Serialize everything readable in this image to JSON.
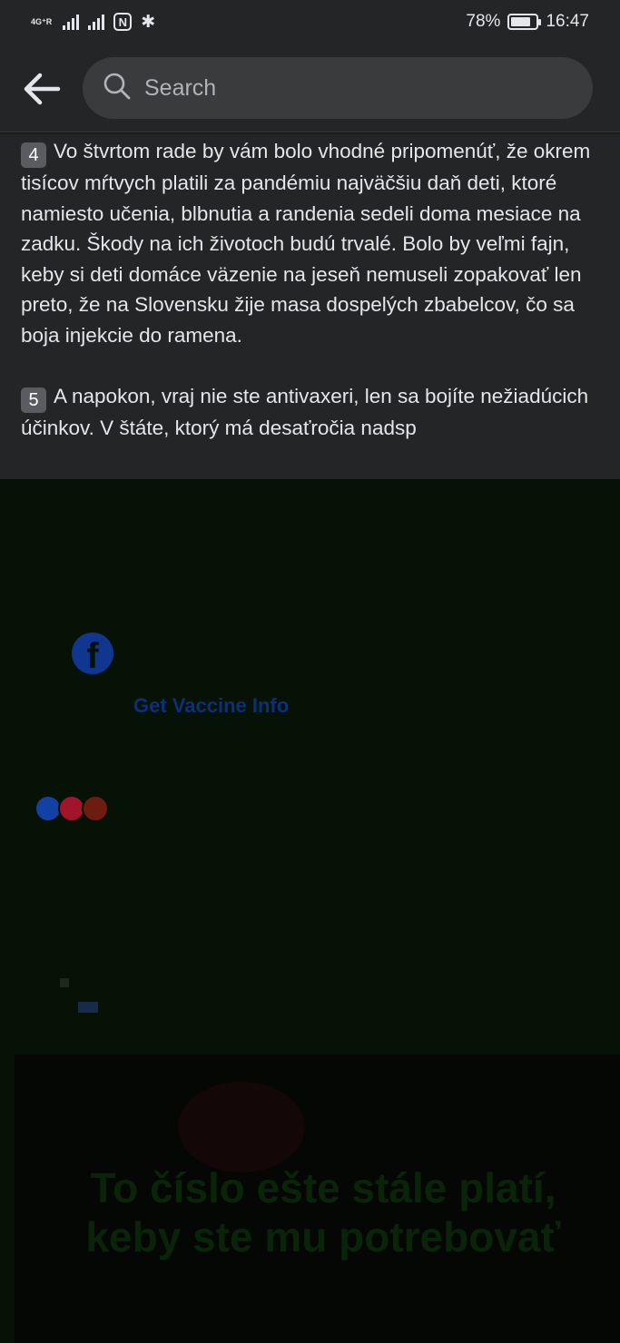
{
  "status_bar": {
    "network": "4G⁺R",
    "battery": "78%",
    "battery_level": 0.78,
    "time": "16:47"
  },
  "header": {
    "search_placeholder": "Search"
  },
  "post": {
    "paragraphs": [
      {
        "number": "4",
        "text": "Vo štvrtom rade by vám bolo vhodné pripomenúť, že okrem tisícov mŕtvych platili za pandémiu najväčšiu daň deti, ktoré namiesto učenia, blbnutia a randenia sedeli doma mesiace na zadku. Škody na ich životoch budú trvalé. Bolo by veľmi fajn, keby si deti domáce väzenie na jeseň nemuseli zopakovať len preto, že na Slovensku žije masa dospelých zbabelcov, čo sa boja injekcie do ramena."
      },
      {
        "number": "5",
        "text": "A napokon, vraj nie ste antivaxeri, len sa bojíte nežiadúcich účinkov. V štáte, ktorý má desaťročia nadsp"
      }
    ]
  },
  "vaccine_link": "Get Vaccine Info",
  "banner": {
    "text": "To číslo ešte stále platí, keby ste mu potrebovať"
  },
  "colors": {
    "surface": "#242526",
    "search_bg": "#3a3b3c",
    "dark_bg": "#071207",
    "facebook_blue": "#10368f"
  }
}
